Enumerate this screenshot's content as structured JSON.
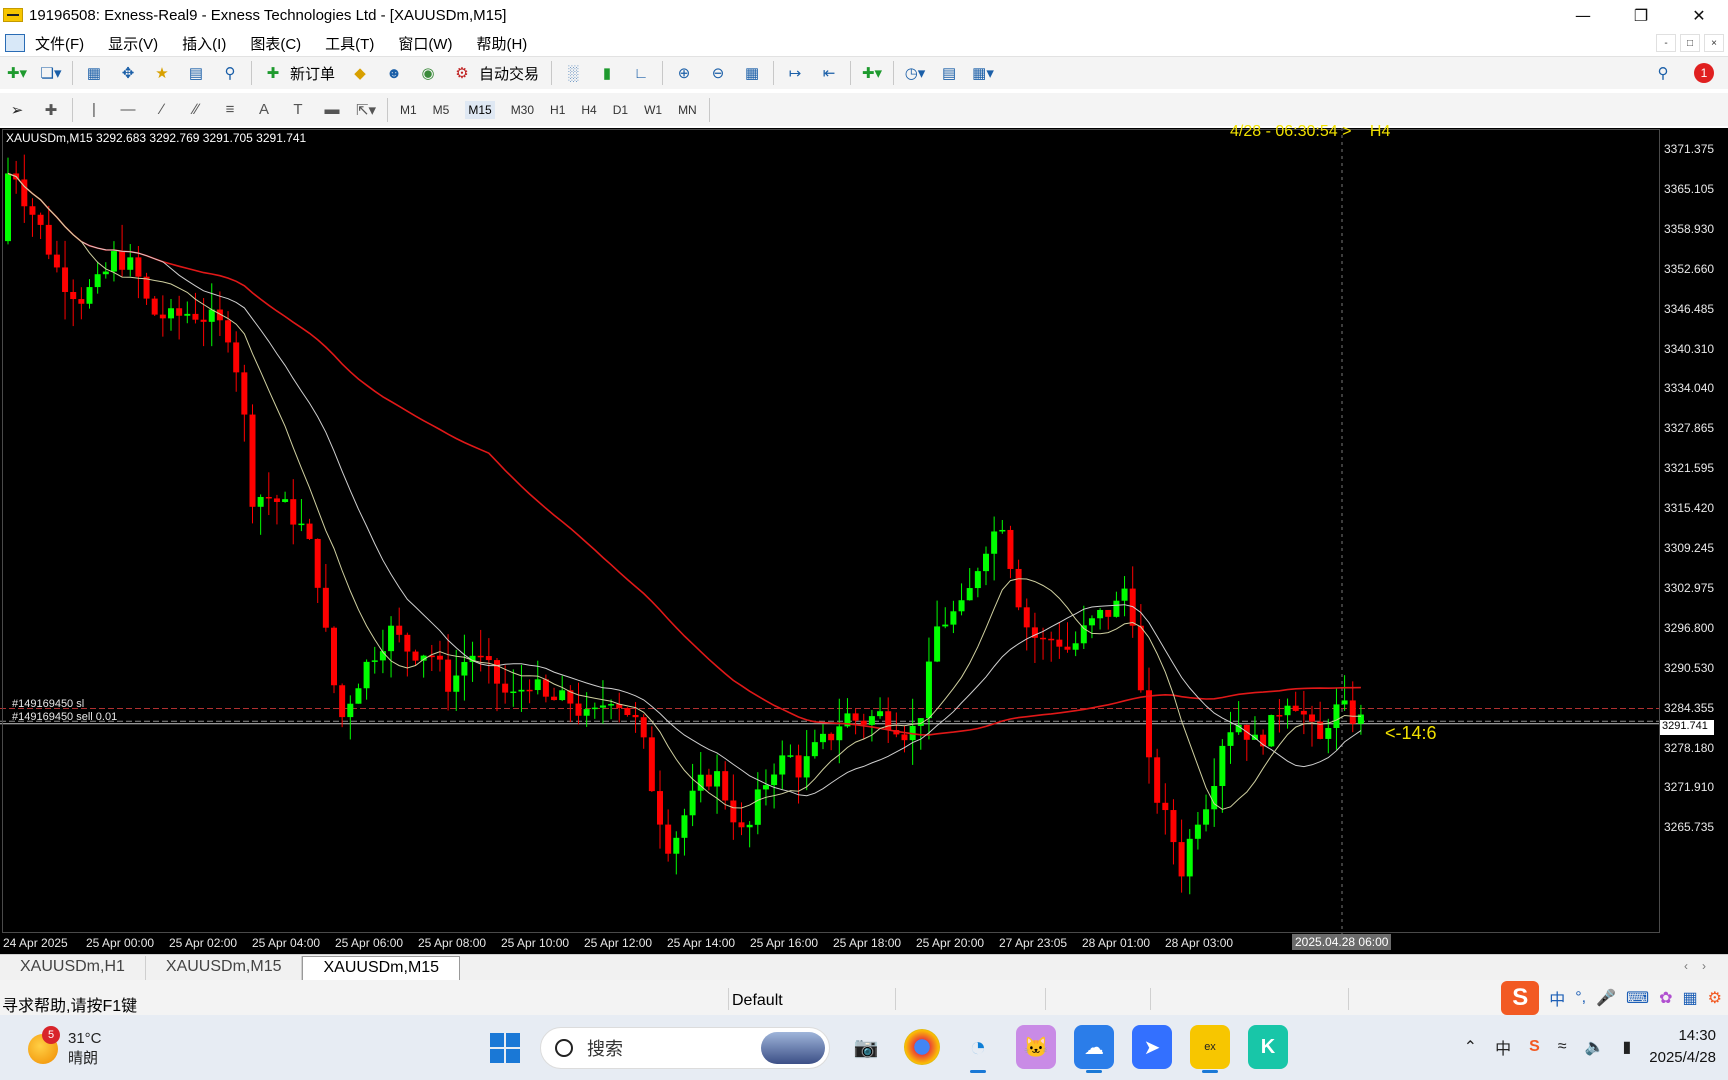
{
  "window": {
    "title": "19196508: Exness-Real9 - Exness Technologies Ltd - [XAUUSDm,M15]"
  },
  "menu": [
    "文件(F)",
    "显示(V)",
    "插入(I)",
    "图表(C)",
    "工具(T)",
    "窗口(W)",
    "帮助(H)"
  ],
  "toolbar": {
    "new_order_label": "新订单",
    "auto_trade_label": "自动交易",
    "notification_count": "1"
  },
  "timeframes": [
    "M1",
    "M5",
    "M15",
    "M30",
    "H1",
    "H4",
    "D1",
    "W1",
    "MN"
  ],
  "active_timeframe": "M15",
  "chart": {
    "info": "XAUUSDm,M15  3292.683 3292.769 3291.705 3291.741",
    "countdown": "4/28 - 06:30:54 >",
    "countdown_tf": "H4",
    "order_sl": "#149169450 sl",
    "order_sell": "#149169450 sell 0.01",
    "current_price": "3291.741",
    "spread": "<-14:6",
    "time_cursor": "2025.04.28 06:00",
    "price_labels": [
      "3371.375",
      "3365.105",
      "3358.930",
      "3352.660",
      "3346.485",
      "3340.310",
      "3334.040",
      "3327.865",
      "3321.595",
      "3315.420",
      "3309.245",
      "3302.975",
      "3296.800",
      "3290.530",
      "3284.355",
      "3278.180",
      "3271.910",
      "3265.735"
    ],
    "time_labels": [
      "24 Apr 2025",
      "25 Apr 00:00",
      "25 Apr 02:00",
      "25 Apr 04:00",
      "25 Apr 06:00",
      "25 Apr 08:00",
      "25 Apr 10:00",
      "25 Apr 12:00",
      "25 Apr 14:00",
      "25 Apr 16:00",
      "25 Apr 18:00",
      "25 Apr 20:00",
      "27 Apr 23:05",
      "28 Apr 01:00",
      "28 Apr 03:00"
    ],
    "colors": {
      "bull": "#00ff00",
      "bear": "#ff0000",
      "ma_slow": "#e01818",
      "ma_fast": "#cfcf9f",
      "ma_mid": "#cfcfcf"
    }
  },
  "tabs": [
    "XAUUSDm,H1",
    "XAUUSDm,M15",
    "XAUUSDm,M15"
  ],
  "active_tab": 2,
  "status": {
    "help": "寻求帮助,请按F1键",
    "profile": "Default"
  },
  "ime": {
    "lang": "中"
  },
  "taskbar": {
    "weather_temp": "31°C",
    "weather_desc": "晴朗",
    "weather_badge": "5",
    "search_placeholder": "搜索",
    "time": "14:30",
    "date": "2025/4/28"
  }
}
